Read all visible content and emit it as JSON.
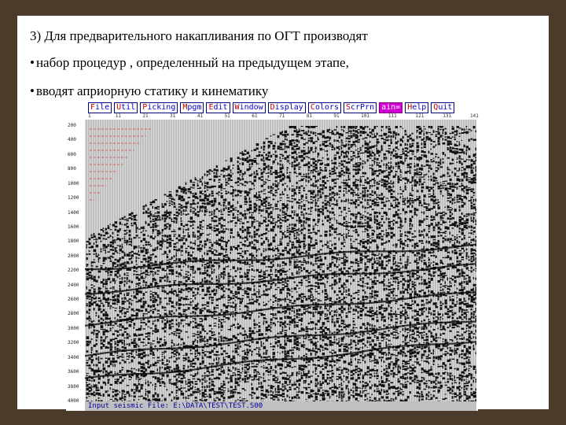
{
  "slide": {
    "heading": "3) Для предварительного накапливания по ОГТ производят",
    "bullets": [
      "набор процедур , определенный на предыдущем этапе,",
      "вводят априорную статику и кинематику"
    ],
    "bullet_glyph": "•"
  },
  "app": {
    "menu": [
      {
        "hot": "F",
        "rest": "ile",
        "active": false
      },
      {
        "hot": "U",
        "rest": "til",
        "active": false
      },
      {
        "hot": "P",
        "rest": "icking",
        "active": false
      },
      {
        "hot": "M",
        "rest": "pgm",
        "active": false
      },
      {
        "hot": "E",
        "rest": "dit",
        "active": false
      },
      {
        "hot": "W",
        "rest": "indow",
        "active": false
      },
      {
        "hot": "D",
        "rest": "isplay",
        "active": false
      },
      {
        "hot": "C",
        "rest": "olors",
        "active": false
      },
      {
        "hot": "S",
        "rest": "crPrn",
        "active": false
      },
      {
        "hot": "",
        "rest": "ain=",
        "active": true
      },
      {
        "hot": "H",
        "rest": "elp",
        "active": false
      },
      {
        "hot": "Q",
        "rest": "uit",
        "active": false
      }
    ],
    "trace_labels": [
      "1",
      "11",
      "21",
      "31",
      "41",
      "51",
      "61",
      "71",
      "81",
      "91",
      "101",
      "111",
      "121",
      "131",
      "141"
    ],
    "time_labels": [
      "200",
      "400",
      "600",
      "800",
      "1000",
      "1200",
      "1400",
      "1600",
      "1800",
      "2000",
      "2200",
      "2400",
      "2600",
      "2800",
      "3000",
      "3200",
      "3400",
      "3600",
      "3800",
      "4000"
    ],
    "status_text": "Input seismic File: E:\\DATA\\TEST\\TEST.S00",
    "colors": {
      "background": "#4a3b2a",
      "menu_text": "#0000c8",
      "menu_hotkey": "#c00000",
      "menu_active": "#d000d0",
      "status_bar": "#c0c0c0"
    }
  }
}
